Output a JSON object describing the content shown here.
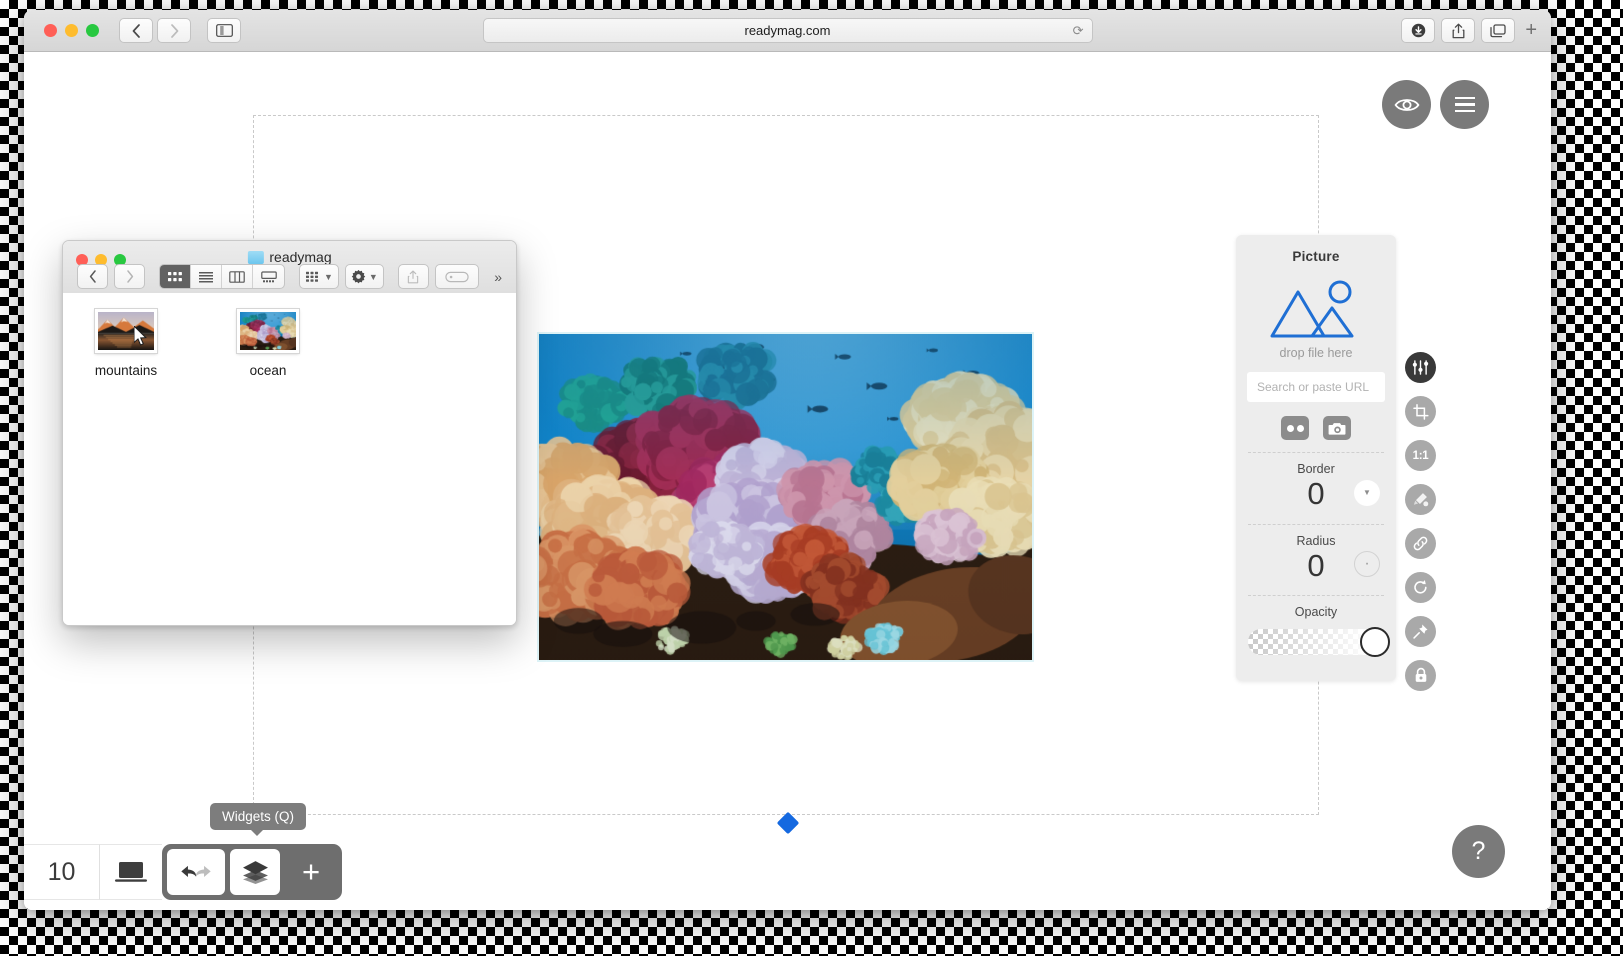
{
  "browser": {
    "url": "readymag.com",
    "back_icon": "chevron-left-icon",
    "forward_icon": "chevron-right-icon",
    "sidebar_icon": "sidebar-toggle-icon",
    "reload_icon": "reload-icon",
    "download_icon": "download-icon",
    "share_icon": "share-icon",
    "tabs_icon": "tabs-icon",
    "new_tab_label": "+"
  },
  "canvas": {
    "preview_icon": "eye-icon",
    "menu_icon": "hamburger-menu-icon",
    "help_label": "?",
    "anchor_icon": "diamond-anchor-icon",
    "image_alt": "coral-reef-photo"
  },
  "finder": {
    "title": "readymag",
    "folder_icon": "folder-icon",
    "toolbar": {
      "back": "chevron-left-icon",
      "forward": "chevron-right-icon",
      "view_icon_grid": "icon-view-icon",
      "view_list": "list-view-icon",
      "view_column": "column-view-icon",
      "view_gallery": "gallery-view-icon",
      "arrange": "arrange-icon",
      "action": "gear-icon",
      "share": "share-icon",
      "tag": "tag-icon",
      "overflow": "double-chevron-icon"
    },
    "files": [
      {
        "label": "mountains",
        "icon": "image-thumbnail",
        "selected": true
      },
      {
        "label": "ocean",
        "icon": "image-thumbnail",
        "selected": false
      }
    ]
  },
  "inspector": {
    "title": "Picture",
    "picture_icon": "picture-placeholder-icon",
    "drop_text": "drop file here",
    "url_placeholder": "Search or paste URL",
    "sources": [
      {
        "name": "flickr-icon"
      },
      {
        "name": "camera-icon"
      }
    ],
    "fields": [
      {
        "label": "Border",
        "value": "0",
        "knob": "chevron-down-icon"
      },
      {
        "label": "Radius",
        "value": "0",
        "knob": "dot-icon"
      }
    ],
    "opacity": {
      "label": "Opacity",
      "handle": "slider-handle"
    },
    "accent_color": "#1f6fd4"
  },
  "tool_rail": [
    {
      "name": "adjustments-icon",
      "label": "",
      "active": true
    },
    {
      "name": "crop-icon",
      "label": "",
      "active": false
    },
    {
      "name": "aspect-ratio-icon",
      "label": "1:1",
      "active": false
    },
    {
      "name": "color-picker-icon",
      "label": "",
      "active": false
    },
    {
      "name": "link-icon",
      "label": "",
      "active": false
    },
    {
      "name": "rotate-icon",
      "label": "",
      "active": false
    },
    {
      "name": "pin-icon",
      "label": "",
      "active": false
    },
    {
      "name": "lock-icon",
      "label": "",
      "active": false
    }
  ],
  "bottom_bar": {
    "page_count": "10",
    "device_icon": "laptop-icon",
    "undo_redo_icon": "undo-redo-icon",
    "widgets_icon": "layers-icon",
    "add_label": "+",
    "tooltip": "Widgets (Q)"
  }
}
